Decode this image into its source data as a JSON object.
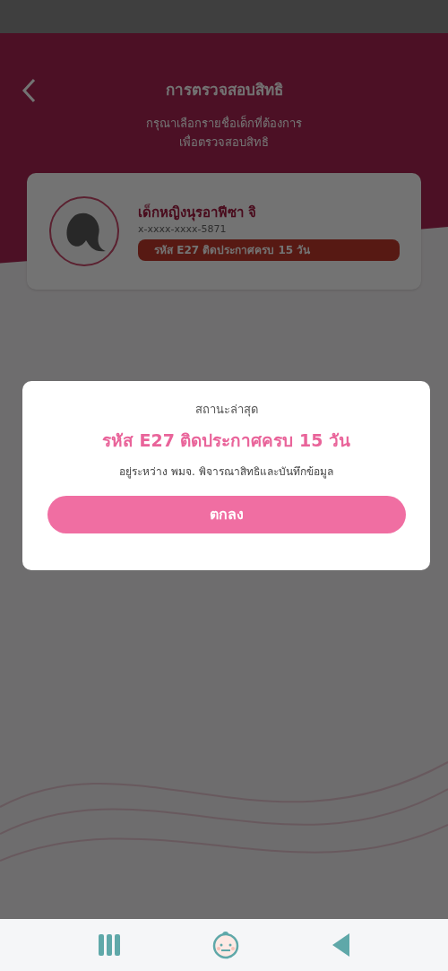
{
  "header": {
    "title": "การตรวจสอบสิทธิ",
    "subtitle_lines": [
      "กรุณาเลือกรายชื่อเด็กที่ต้องการ",
      "เพื่อตรวจสอบสิทธิ"
    ]
  },
  "children": [
    {
      "name": "เด็กหญิงนุรอาฟีซา จิ",
      "id_number": "x-xxxx-xxxx-5871",
      "status": "รหัส E27  ติดประกาศครบ 15 วัน"
    }
  ],
  "dialog": {
    "label": "สถานะล่าสุด",
    "status": "รหัส E27  ติดประกาศครบ 15 วัน",
    "description": "อยู่ระหว่าง พมจ. พิจารณาสิทธิและบันทึกข้อมูล",
    "button": "ตกลง"
  }
}
